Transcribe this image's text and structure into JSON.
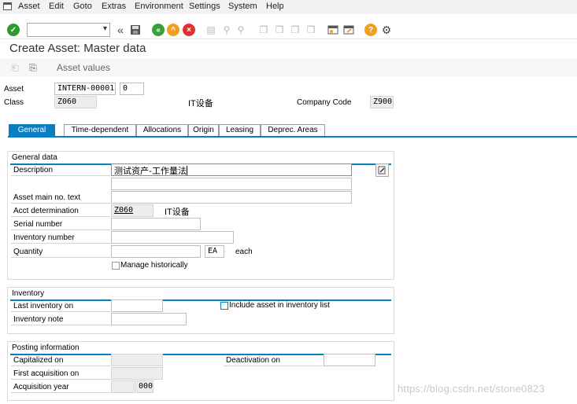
{
  "menu": [
    "Asset",
    "Edit",
    "Goto",
    "Extras",
    "Environment",
    "Settings",
    "System",
    "Help"
  ],
  "toolbar": {
    "command_field_value": "",
    "icons": [
      "enter-icon",
      "back-double-icon",
      "save-icon",
      "back-icon",
      "exit-icon",
      "cancel-icon",
      "print-icon",
      "find-icon",
      "find-next-icon",
      "first-page-icon",
      "previous-page-icon",
      "next-page-icon",
      "last-page-icon",
      "create-session-icon",
      "shortcut-icon",
      "help-icon",
      "customize-layout-icon"
    ]
  },
  "title": "Create Asset:  Master data",
  "subtoolbar": {
    "asset_values_label": "Asset values"
  },
  "header": {
    "asset_label": "Asset",
    "asset_number": "INTERN-00001",
    "asset_subnumber": "0",
    "class_label": "Class",
    "class_value": "Z060",
    "class_text": "IT设备",
    "company_code_label": "Company Code",
    "company_code_value": "Z900"
  },
  "tabs": [
    "General",
    "Time-dependent",
    "Allocations",
    "Origin",
    "Leasing",
    "Deprec. Areas"
  ],
  "active_tab": "General",
  "general_data": {
    "title": "General data",
    "description_label": "Description",
    "description_value": "测试资产-工作量法",
    "description_line2": "",
    "main_text_label": "Asset main no. text",
    "main_text_value": "",
    "acct_det_label": "Acct determination",
    "acct_det_value": "Z060",
    "acct_det_text": "IT设备",
    "serial_label": "Serial number",
    "serial_value": "",
    "inventory_no_label": "Inventory number",
    "inventory_no_value": "",
    "quantity_label": "Quantity",
    "quantity_value": "",
    "unit_value": "EA",
    "unit_text": "each",
    "manage_hist_label": "Manage historically"
  },
  "inventory": {
    "title": "Inventory",
    "last_inventory_label": "Last inventory on",
    "last_inventory_value": "",
    "include_label": "Include asset in inventory list",
    "note_label": "Inventory note",
    "note_value": ""
  },
  "posting": {
    "title": "Posting information",
    "capitalized_label": "Capitalized on",
    "first_acq_label": "First acquisition on",
    "acq_year_label": "Acquisition year",
    "acq_year_value": "",
    "acq_period_value": "000",
    "deactivation_label": "Deactivation on",
    "deactivation_value": ""
  },
  "watermark": "https://blog.csdn.net/stone0823",
  "colors": {
    "accent": "#0a7ec2",
    "enter_green": "#2e9a2e",
    "nav_green": "#3aa13a",
    "nav_orange": "#f0a020",
    "cancel_red": "#e03030",
    "help_orange": "#f0a020"
  }
}
